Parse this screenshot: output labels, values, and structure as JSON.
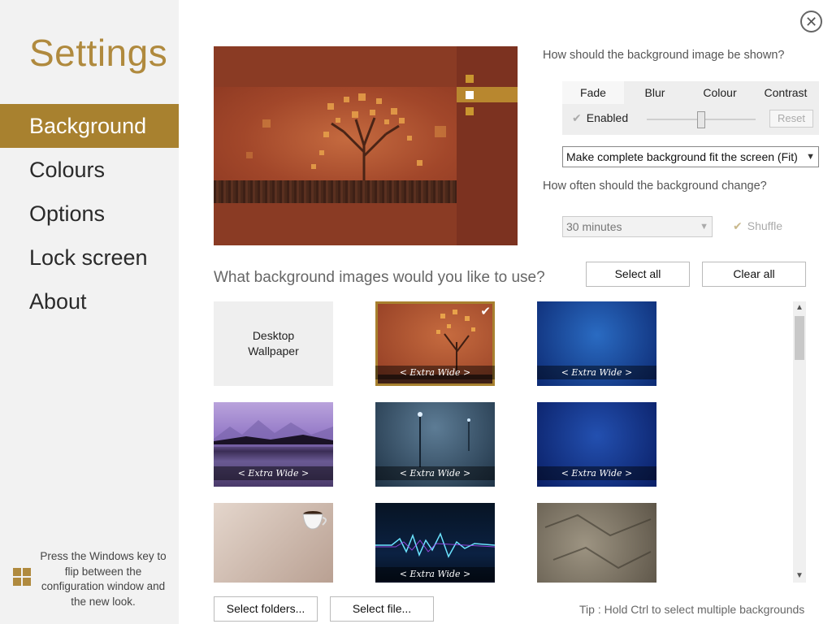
{
  "sidebar": {
    "title": "Settings",
    "items": [
      {
        "label": "Background",
        "active": true
      },
      {
        "label": "Colours"
      },
      {
        "label": "Options"
      },
      {
        "label": "Lock screen"
      },
      {
        "label": "About"
      }
    ],
    "hint": "Press the Windows key to flip between the configuration window and the new look."
  },
  "colors": {
    "accent": "#a8812f",
    "title": "#b08a3e",
    "sidebar_bg": "#f2f2f2"
  },
  "icons": {
    "close": "close-icon",
    "windows": "windows-logo-icon",
    "check": "checkmark-icon"
  },
  "display": {
    "question": "How should the background image be shown?",
    "tabs": [
      "Fade",
      "Blur",
      "Colour",
      "Contrast"
    ],
    "active_tab": "Fade",
    "enabled_label": "Enabled",
    "reset_label": "Reset",
    "fade_level": 0.5,
    "fit_selected": "Make complete background fit the screen (Fit)"
  },
  "change": {
    "question": "How often should the background change?",
    "interval": "30 minutes",
    "shuffle_label": "Shuffle"
  },
  "images": {
    "question": "What background images would you like to use?",
    "select_all": "Select all",
    "clear_all": "Clear all",
    "desktop_line1": "Desktop",
    "desktop_line2": "Wallpaper",
    "caption": "< Extra Wide >"
  },
  "footer": {
    "select_folders": "Select folders...",
    "select_file": "Select file...",
    "tip": "Tip : Hold Ctrl to select multiple backgrounds"
  }
}
